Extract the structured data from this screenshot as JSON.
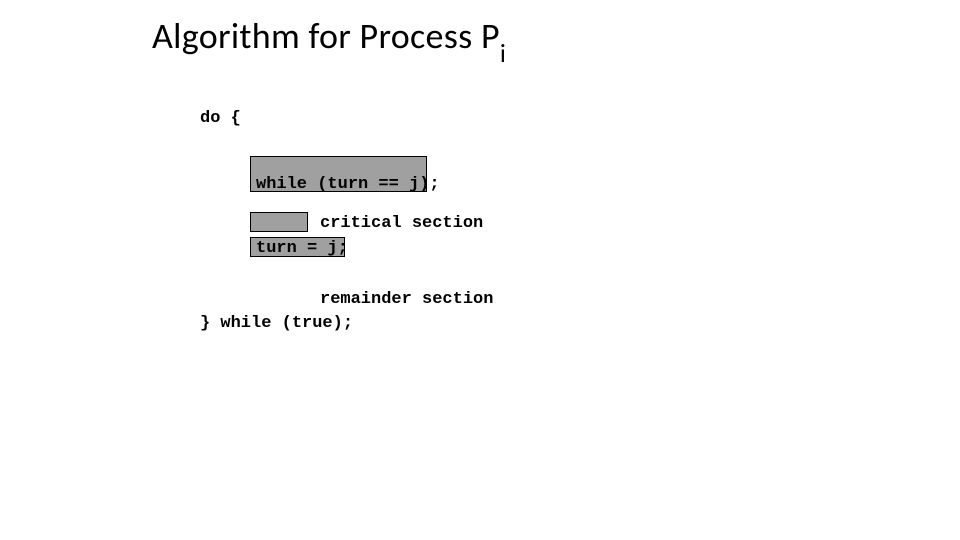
{
  "title": {
    "main": "Algorithm for Process P",
    "subscript": "i"
  },
  "code": {
    "l1": "do {",
    "box1": "while (turn == j);",
    "critical": "critical section",
    "box3": "turn = j;",
    "remainder": "remainder section",
    "end": "} while (true);"
  }
}
